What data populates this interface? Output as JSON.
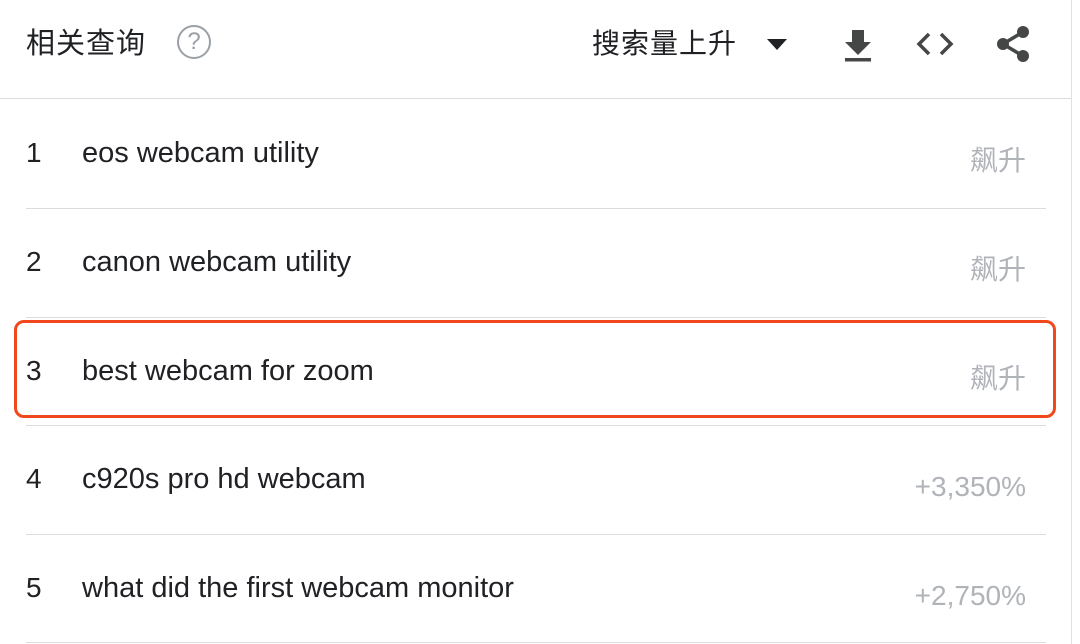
{
  "header": {
    "title": "相关查询",
    "help_glyph": "?",
    "sort_label": "搜索量上升",
    "icons": [
      "download-icon",
      "embed-code-icon",
      "share-icon"
    ]
  },
  "rows": [
    {
      "rank": "1",
      "query": "eos webcam utility",
      "value": "飙升"
    },
    {
      "rank": "2",
      "query": "canon webcam utility",
      "value": "飙升"
    },
    {
      "rank": "3",
      "query": "best webcam for zoom",
      "value": "飙升"
    },
    {
      "rank": "4",
      "query": "c920s pro hd webcam",
      "value": "+3,350%"
    },
    {
      "rank": "5",
      "query": "what did the first webcam monitor",
      "value": "+2,750%"
    }
  ],
  "colors": {
    "highlight": "#f1471d",
    "muted_value": "#b0b3b8",
    "text": "#202124",
    "divider": "#dadce0"
  }
}
